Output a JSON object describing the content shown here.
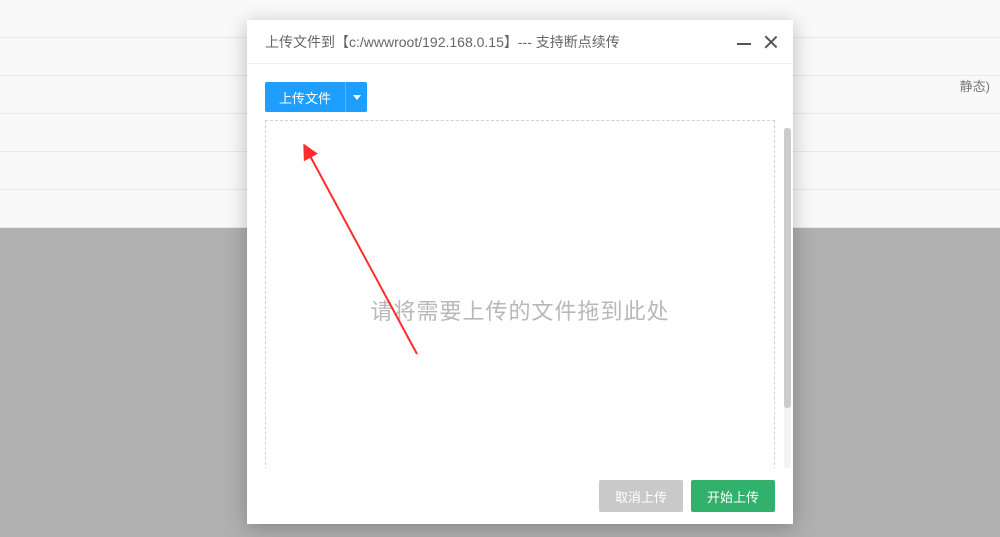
{
  "background": {
    "partial_text": "静态)"
  },
  "modal": {
    "title": "上传文件到【c:/wwwroot/192.168.0.15】--- 支持断点续传",
    "upload_button_label": "上传文件",
    "drop_zone_text": "请将需要上传的文件拖到此处",
    "footer": {
      "cancel_label": "取消上传",
      "submit_label": "开始上传"
    }
  }
}
